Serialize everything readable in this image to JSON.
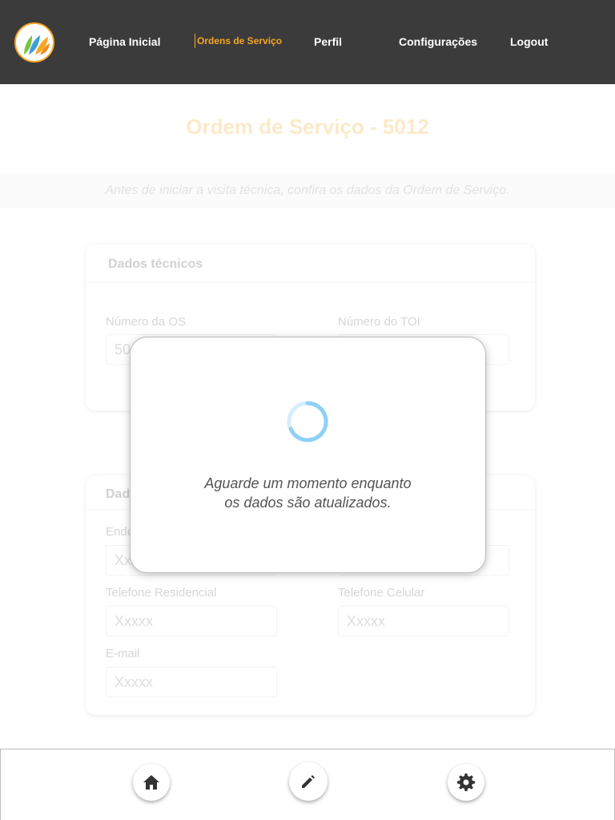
{
  "header": {
    "logo_icon": "leaf-drops-logo-icon",
    "nav": [
      {
        "label": "Página Inicial",
        "active": false
      },
      {
        "label": "Ordens de Serviço",
        "active": true
      },
      {
        "label": "Perfil",
        "active": false
      },
      {
        "label": "Configurações",
        "active": false
      },
      {
        "label": "Logout",
        "active": false
      }
    ]
  },
  "page": {
    "title": "Ordem de Serviço - 5012",
    "subtitle": "Antes de iniciar a visita técnica, confira os dados da Ordem de Serviço."
  },
  "technical_card": {
    "title": "Dados técnicos",
    "os_number_label": "Número da OS",
    "os_number_value": "5012",
    "toi_number_label": "Número do TOI",
    "toi_number_value": ""
  },
  "client_card": {
    "title": "Dados",
    "address_label": "Endereço",
    "address_value": "Xxxxx",
    "residential_phone_label": "Telefone Residencial",
    "residential_phone_placeholder": "Xxxxx",
    "mobile_phone_label": "Telefone Celular",
    "mobile_phone_placeholder": "Xxxxx",
    "email_label": "E-mail",
    "email_placeholder": "Xxxxx"
  },
  "loading_modal": {
    "message_line1": "Aguarde um momento enquanto",
    "message_line2": "os dados são atualizados."
  },
  "bottom_bar": {
    "buttons": [
      "home-icon",
      "pencil-icon",
      "gear-icon"
    ]
  },
  "colors": {
    "header_bg": "#3b3b3b",
    "accent": "#f5a623",
    "spinner": "#8fd0f5"
  }
}
